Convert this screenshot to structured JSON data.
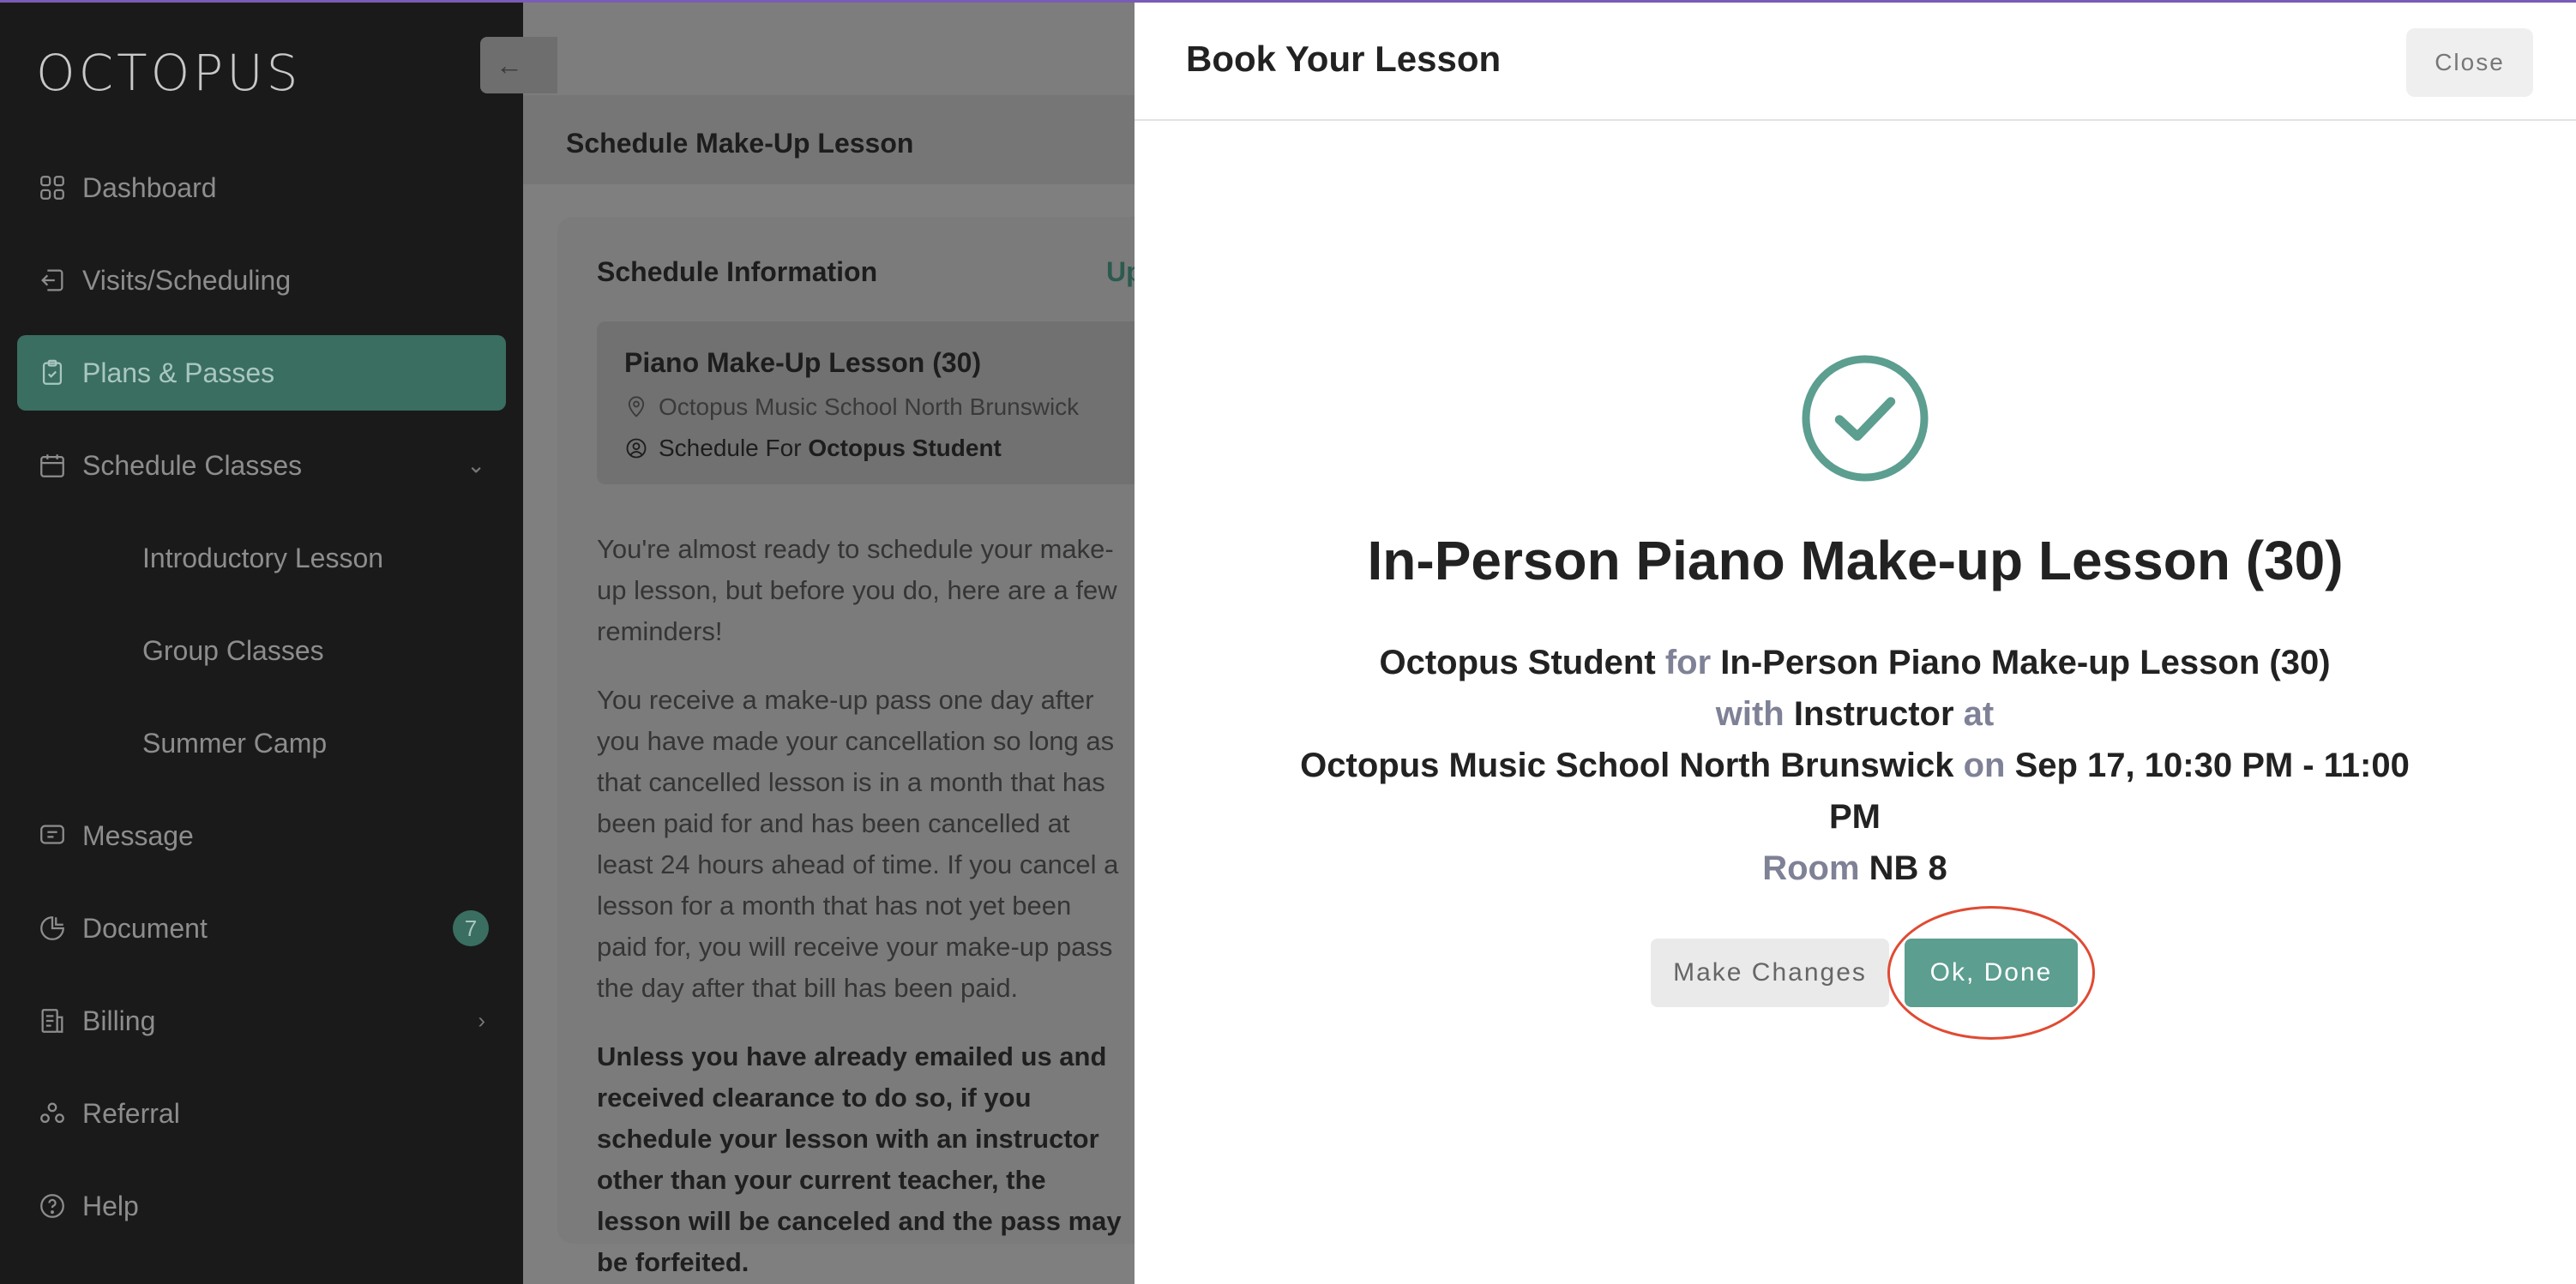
{
  "app": {
    "logo": "OCTOPUS"
  },
  "sidebar": {
    "items": [
      {
        "label": "Dashboard",
        "icon": "grid-icon"
      },
      {
        "label": "Visits/Scheduling",
        "icon": "return-icon"
      },
      {
        "label": "Plans & Passes",
        "icon": "clipboard-check-icon",
        "active": true
      },
      {
        "label": "Schedule Classes",
        "icon": "calendar-icon",
        "trail": "chevron-down-icon"
      },
      {
        "label": "Message",
        "icon": "message-icon"
      },
      {
        "label": "Document",
        "icon": "document-icon",
        "badge": "7"
      },
      {
        "label": "Billing",
        "icon": "billing-icon",
        "trail": "chevron-right-icon"
      },
      {
        "label": "Referral",
        "icon": "referral-icon"
      },
      {
        "label": "Help",
        "icon": "help-icon"
      }
    ],
    "sub_items": [
      "Introductory Lesson",
      "Group Classes",
      "Summer Camp"
    ]
  },
  "main": {
    "page_title": "Schedule Make-Up Lesson",
    "card_title": "Schedule Information",
    "card_link_partial": "Up",
    "lesson": {
      "title": "Piano Make-Up Lesson (30)",
      "location": "Octopus Music School North Brunswick",
      "schedule_for_prefix": "Schedule For ",
      "schedule_for_name": "Octopus Student"
    },
    "paragraphs": [
      "You're almost ready to schedule your make-up lesson, but before you do, here are a few reminders!",
      "You receive a make-up pass one day after you have made your cancellation so long as that cancelled lesson is in a month that has been paid for and has been cancelled at least 24 hours ahead of time. If you cancel a lesson for a month that has not yet been paid for, you will receive your make-up pass the day after that bill has been paid.",
      "Unless you have already emailed us and received clearance to do so, if you schedule your lesson with an instructor other than your current teacher, the lesson will be canceled and the pass may be forfeited."
    ]
  },
  "modal": {
    "title": "Book Your Lesson",
    "close_label": "Close",
    "confirmation_title": "In-Person Piano Make-up Lesson (30)",
    "student": "Octopus Student",
    "for_word": "for",
    "lesson_name": "In-Person Piano Make-up Lesson (30)",
    "with_word": "with",
    "instructor": "Instructor",
    "at_word": "at",
    "location": "Octopus Music School North Brunswick",
    "on_word": "on",
    "datetime": "Sep 17, 10:30 PM - 11:00 PM",
    "room_word": "Room",
    "room": "NB 8",
    "make_changes_label": "Make Changes",
    "done_label": "Ok, Done"
  },
  "colors": {
    "accent": "#5c9e90",
    "sidebar_bg": "#1a1a1a",
    "annotation": "#e04a33"
  }
}
